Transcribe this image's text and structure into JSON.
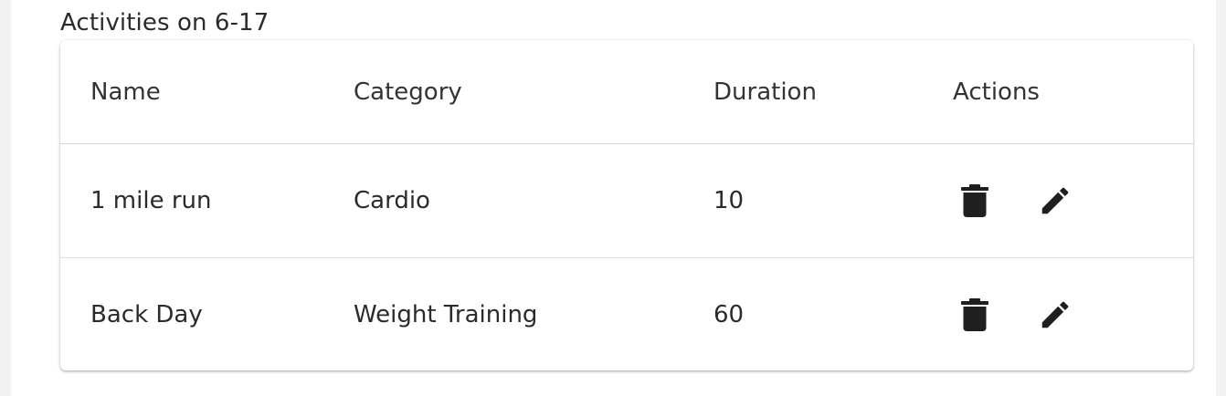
{
  "section": {
    "title": "Activities on 6-17"
  },
  "table": {
    "headers": {
      "name": "Name",
      "category": "Category",
      "duration": "Duration",
      "actions": "Actions"
    },
    "rows": [
      {
        "name": "1 mile run",
        "category": "Cardio",
        "duration": "10"
      },
      {
        "name": "Back Day",
        "category": "Weight Training",
        "duration": "60"
      }
    ]
  },
  "icons": {
    "delete": "delete-icon",
    "edit": "edit-pencil-icon"
  },
  "colors": {
    "icon": "#1f1f1f",
    "divider": "#e0e0e0"
  }
}
